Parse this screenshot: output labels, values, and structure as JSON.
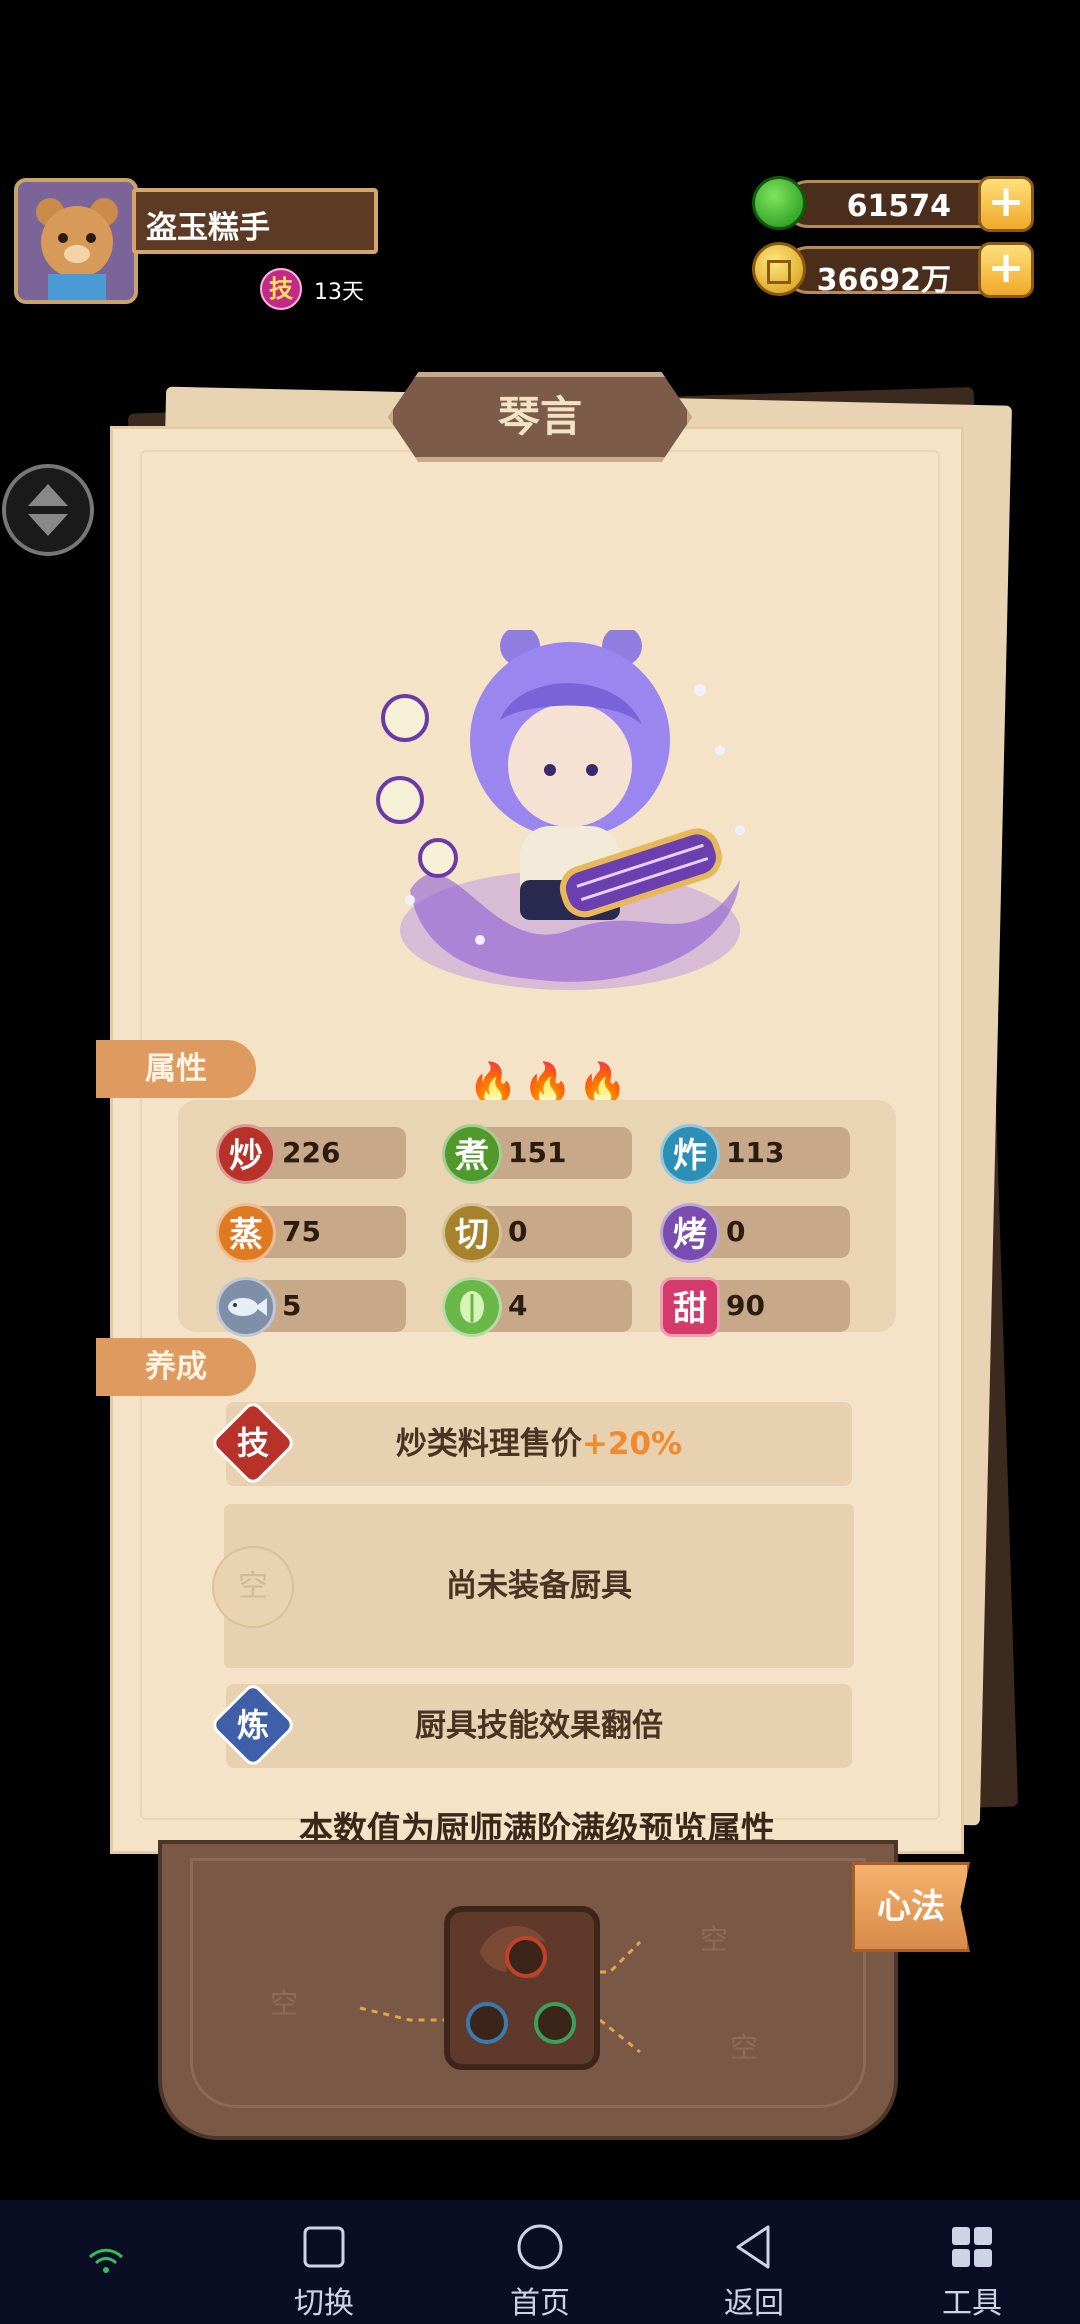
{
  "player": {
    "name": "盗玉糕手",
    "buff_icon": "技",
    "buff_days": "13天"
  },
  "currency": [
    {
      "icon": "jade-gem-icon",
      "value": "61574",
      "color": "#2db52a"
    },
    {
      "icon": "gold-coin-icon",
      "value": "36692万",
      "color": "#f2c230"
    }
  ],
  "chef": {
    "name": "琴言",
    "stars": 3,
    "attributes_tab": "属性",
    "cultivation_tab": "养成",
    "stats": [
      {
        "icon": "炒",
        "value": "226",
        "color": "#b8322a"
      },
      {
        "icon": "煮",
        "value": "151",
        "color": "#4f9a2a"
      },
      {
        "icon": "炸",
        "value": "113",
        "color": "#2b8fb8"
      },
      {
        "icon": "蒸",
        "value": "75",
        "color": "#e07a22"
      },
      {
        "icon": "切",
        "value": "0",
        "color": "#a8822a"
      },
      {
        "icon": "烤",
        "value": "0",
        "color": "#7a4cb0"
      },
      {
        "icon": "fish-icon",
        "value": "5",
        "color": "#7f8fa8"
      },
      {
        "icon": "cabbage-icon",
        "value": "4",
        "color": "#6ab84a"
      },
      {
        "icon": "甜",
        "value": "90",
        "color": "#d63a6a"
      }
    ],
    "skill": {
      "icon": "技",
      "text": "炒类料理售价",
      "bonus": "+20%"
    },
    "equipment": {
      "slot_label": "空",
      "text": "尚未装备厨具"
    },
    "refine": {
      "icon": "炼",
      "text": "厨具技能效果翻倍"
    },
    "footnote": "本数值为厨师满阶满级预览属性"
  },
  "heart_method": {
    "button": "心法",
    "slots": [
      "空",
      "空",
      "空"
    ]
  },
  "navbar": {
    "items": [
      {
        "label": "切换",
        "icon": "square-icon"
      },
      {
        "label": "首页",
        "icon": "circle-icon"
      },
      {
        "label": "返回",
        "icon": "back-triangle-icon"
      },
      {
        "label": "工具",
        "icon": "grid-icon"
      }
    ]
  }
}
